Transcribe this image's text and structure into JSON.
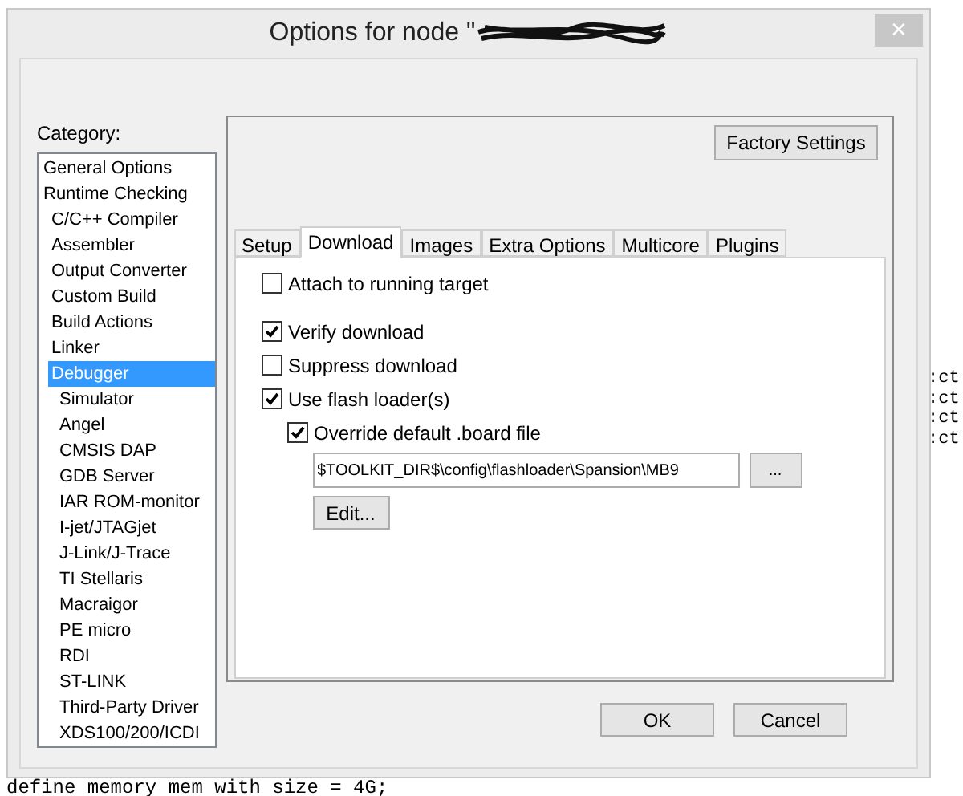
{
  "background_code": {
    "side_lines": [
      ":ct",
      ":ct",
      ":ct",
      ":ct"
    ],
    "bottom_line": "define memory mem with size = 4G;"
  },
  "window": {
    "title": "Options for node \"",
    "title_redacted": true,
    "close": "✕"
  },
  "category": {
    "label": "Category:",
    "items": [
      {
        "label": "General Options",
        "selected": false
      },
      {
        "label": "Runtime Checking",
        "selected": false,
        "children": [
          {
            "label": "C/C++ Compiler",
            "selected": false
          },
          {
            "label": "Assembler",
            "selected": false
          },
          {
            "label": "Output Converter",
            "selected": false
          },
          {
            "label": "Custom Build",
            "selected": false
          },
          {
            "label": "Build Actions",
            "selected": false
          },
          {
            "label": "Linker",
            "selected": false
          },
          {
            "label": "Debugger",
            "selected": true,
            "children": [
              {
                "label": "Simulator",
                "selected": false
              },
              {
                "label": "Angel",
                "selected": false
              },
              {
                "label": "CMSIS DAP",
                "selected": false
              },
              {
                "label": "GDB Server",
                "selected": false
              },
              {
                "label": "IAR ROM-monitor",
                "selected": false
              },
              {
                "label": "I-jet/JTAGjet",
                "selected": false
              },
              {
                "label": "J-Link/J-Trace",
                "selected": false
              },
              {
                "label": "TI Stellaris",
                "selected": false
              },
              {
                "label": "Macraigor",
                "selected": false
              },
              {
                "label": "PE micro",
                "selected": false
              },
              {
                "label": "RDI",
                "selected": false
              },
              {
                "label": "ST-LINK",
                "selected": false
              },
              {
                "label": "Third-Party Driver",
                "selected": false
              },
              {
                "label": "XDS100/200/ICDI",
                "selected": false
              }
            ]
          }
        ]
      }
    ]
  },
  "factory_settings": "Factory Settings",
  "tabs": [
    {
      "label": "Setup",
      "selected": false
    },
    {
      "label": "Download",
      "selected": true
    },
    {
      "label": "Images",
      "selected": false
    },
    {
      "label": "Extra Options",
      "selected": false
    },
    {
      "label": "Multicore",
      "selected": false
    },
    {
      "label": "Plugins",
      "selected": false
    }
  ],
  "options": [
    {
      "label": "Attach to running target",
      "checked": false
    },
    {
      "label": "Verify download",
      "checked": true
    },
    {
      "label": "Suppress download",
      "checked": false
    },
    {
      "label": "Use flash loader(s)",
      "checked": true,
      "children": [
        {
          "label": "Override default .board file",
          "checked": true
        }
      ]
    }
  ],
  "board_file": {
    "value": "$TOOLKIT_DIR$\\config\\flashloader\\Spansion\\MB9",
    "browse": "...",
    "edit": "Edit..."
  },
  "buttons": [
    "OK",
    "Cancel"
  ]
}
